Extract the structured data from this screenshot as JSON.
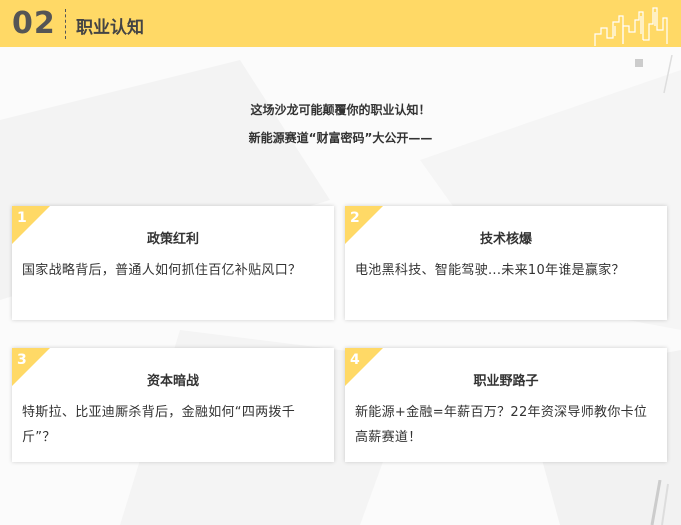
{
  "header": {
    "number": "02",
    "title": "职业认知"
  },
  "intro": {
    "line1": "这场沙龙可能颠覆你的职业认知！",
    "line2": "新能源赛道“财富密码”大公开——"
  },
  "cards": [
    {
      "index": "1",
      "title": "政策红利",
      "body": "国家战略背后，普通人如何抓住百亿补贴风口？"
    },
    {
      "index": "2",
      "title": "技术核爆",
      "body": "电池黑科技、智能驾驶...未来10年谁是赢家？"
    },
    {
      "index": "3",
      "title": "资本暗战",
      "body": "特斯拉、比亚迪厮杀背后，金融如何“四两拨千斤”？"
    },
    {
      "index": "4",
      "title": "职业野路子",
      "body": "新能源+金融=年薪百万？22年资深导师教你卡位高薪赛道！"
    }
  ],
  "colors": {
    "accent": "#ffd966",
    "text": "#333333",
    "header_text": "#555555"
  }
}
